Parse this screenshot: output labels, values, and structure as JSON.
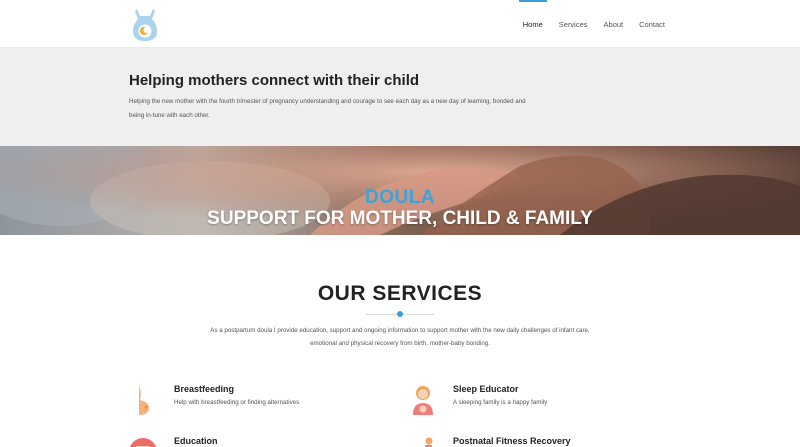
{
  "nav": {
    "items": [
      {
        "label": "Home",
        "active": true
      },
      {
        "label": "Services",
        "active": false
      },
      {
        "label": "About",
        "active": false
      },
      {
        "label": "Contact",
        "active": false
      }
    ]
  },
  "hero": {
    "title": "Helping mothers connect with their child",
    "text": "Helping the new mother with the fourth trimester of pregnancy understanding and courage to see each day as a new day of learning, bonded and being in-tune with each other."
  },
  "banner": {
    "kicker": "DOULA",
    "tagline": "SUPPORT FOR MOTHER, CHILD & FAMILY"
  },
  "services": {
    "title": "OUR SERVICES",
    "intro": "As a postpartum doula I provide education, support and ongoing information to support mother with the new daily challenges of infant care, emotional and physical recovery from birth, mother-baby bonding.",
    "items": [
      {
        "title": "Breastfeeding",
        "desc": "Help with breastfeeding or finding alternatives",
        "icon": "breastfeeding-icon"
      },
      {
        "title": "Sleep Educator",
        "desc": "A sleeping family is a happy family",
        "icon": "sleeping-mother-icon"
      },
      {
        "title": "Education",
        "desc": "",
        "icon": "education-icon"
      },
      {
        "title": "Postnatal Fitness Recovery",
        "desc": "",
        "icon": "fitness-icon"
      }
    ]
  },
  "colors": {
    "accent": "#3a9fd6",
    "hero_bg": "#efefef"
  }
}
